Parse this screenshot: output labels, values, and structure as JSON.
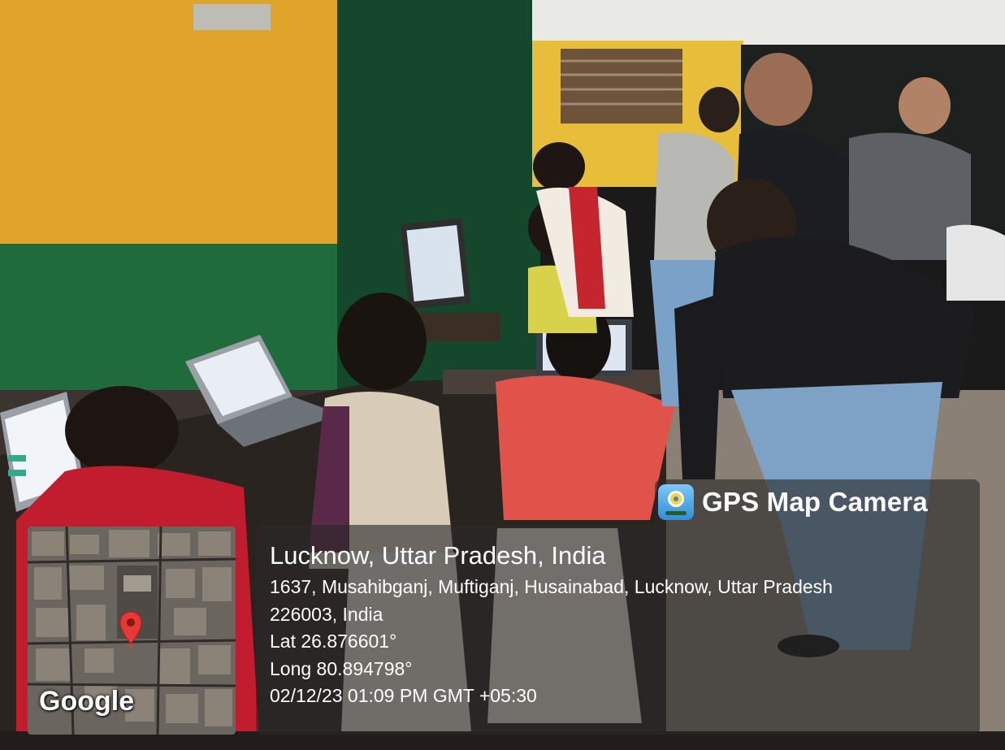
{
  "overlay": {
    "app_name": "GPS Map Camera",
    "app_icon": "gps-map-camera-app-icon",
    "location_title": "Lucknow, Uttar Pradesh, India",
    "address_line1": "1637, Musahibganj, Muftiganj, Husainabad, Lucknow, Uttar Pradesh",
    "address_line2": "226003, India",
    "latitude": "Lat 26.876601°",
    "longitude": "Long 80.894798°",
    "timestamp": "02/12/23 01:09 PM GMT +05:30"
  },
  "map": {
    "provider_label": "Google",
    "marker_icon": "map-pin-icon",
    "marker_color": "#e53935"
  },
  "colors": {
    "wall_yellow": "#e0a42a",
    "wall_green": "#1f6b3c",
    "door_green": "#15472c",
    "overlay_bg": "#282828"
  }
}
